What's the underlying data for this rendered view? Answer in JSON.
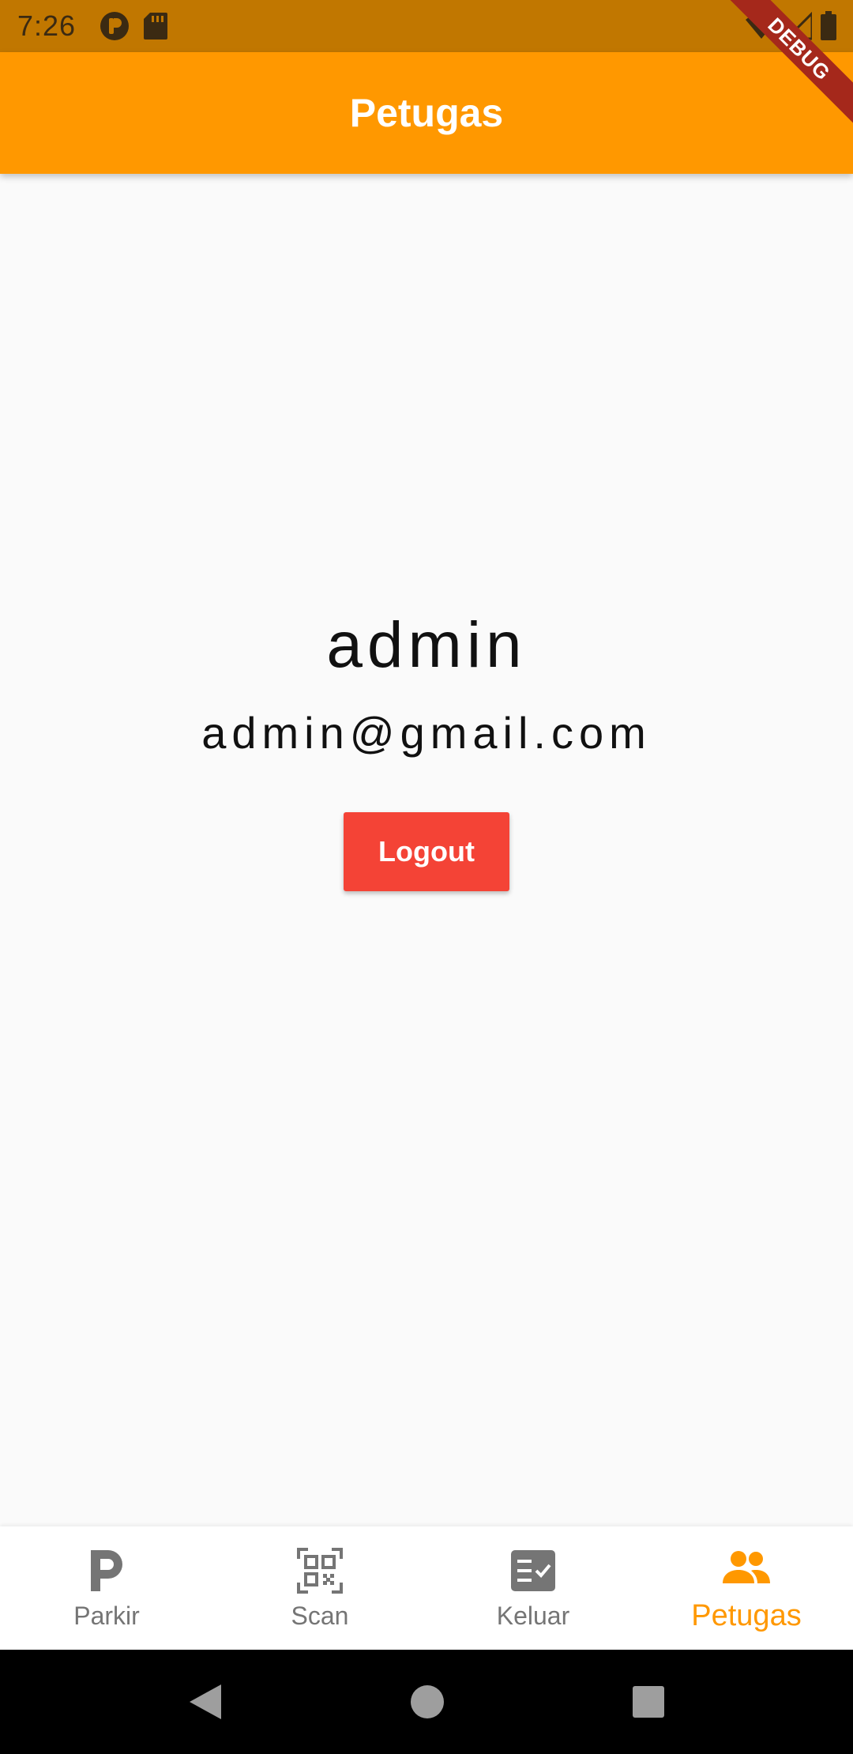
{
  "status_bar": {
    "time": "7:26"
  },
  "app_bar": {
    "title": "Petugas"
  },
  "debug_banner": {
    "label": "DEBUG"
  },
  "profile": {
    "name": "admin",
    "email": "admin@gmail.com",
    "logout_label": "Logout"
  },
  "bottom_nav": {
    "items": [
      {
        "label": "Parkir",
        "icon": "parking-icon"
      },
      {
        "label": "Scan",
        "icon": "qr-code-icon"
      },
      {
        "label": "Keluar",
        "icon": "checklist-icon"
      },
      {
        "label": "Petugas",
        "icon": "people-icon",
        "active": true
      }
    ]
  },
  "colors": {
    "accent": "#ff9800",
    "status_bar": "#c17700",
    "logout": "#f44336",
    "inactive": "#757575"
  }
}
